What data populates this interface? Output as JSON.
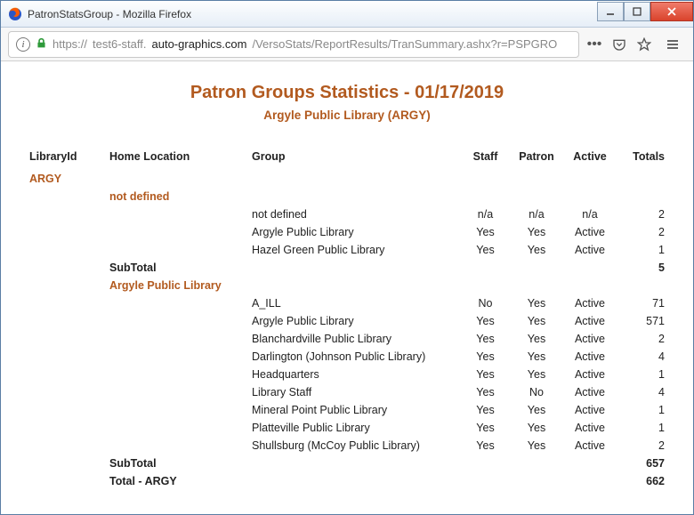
{
  "window": {
    "title": "PatronStatsGroup - Mozilla Firefox"
  },
  "address": {
    "protocol": "https://",
    "host_pre": "test6-staff.",
    "host_main": "auto-graphics.com",
    "path": "/VersoStats/ReportResults/TranSummary.ashx?r=PSPGRO"
  },
  "report": {
    "title": "Patron Groups Statistics  -  01/17/2019",
    "subtitle": "Argyle Public Library (ARGY)"
  },
  "columns": {
    "c0": "LibraryId",
    "c1": "Home Location",
    "c2": "Group",
    "c3": "Staff",
    "c4": "Patron",
    "c5": "Active",
    "c6": "Totals"
  },
  "library_id": "ARGY",
  "sections": [
    {
      "name": "not defined",
      "rows": [
        {
          "group": "not defined",
          "staff": "n/a",
          "patron": "n/a",
          "active": "n/a",
          "total": "2"
        },
        {
          "group": "Argyle Public Library",
          "staff": "Yes",
          "patron": "Yes",
          "active": "Active",
          "total": "2"
        },
        {
          "group": "Hazel Green Public Library",
          "staff": "Yes",
          "patron": "Yes",
          "active": "Active",
          "total": "1"
        }
      ],
      "subtotal_label": "SubTotal",
      "subtotal": "5"
    },
    {
      "name": "Argyle Public Library",
      "rows": [
        {
          "group": "A_ILL",
          "staff": "No",
          "patron": "Yes",
          "active": "Active",
          "total": "71"
        },
        {
          "group": "Argyle Public Library",
          "staff": "Yes",
          "patron": "Yes",
          "active": "Active",
          "total": "571"
        },
        {
          "group": "Blanchardville Public Library",
          "staff": "Yes",
          "patron": "Yes",
          "active": "Active",
          "total": "2"
        },
        {
          "group": "Darlington (Johnson Public Library)",
          "staff": "Yes",
          "patron": "Yes",
          "active": "Active",
          "total": "4"
        },
        {
          "group": "Headquarters",
          "staff": "Yes",
          "patron": "Yes",
          "active": "Active",
          "total": "1"
        },
        {
          "group": "Library Staff",
          "staff": "Yes",
          "patron": "No",
          "active": "Active",
          "total": "4"
        },
        {
          "group": "Mineral Point Public Library",
          "staff": "Yes",
          "patron": "Yes",
          "active": "Active",
          "total": "1"
        },
        {
          "group": "Platteville Public Library",
          "staff": "Yes",
          "patron": "Yes",
          "active": "Active",
          "total": "1"
        },
        {
          "group": "Shullsburg (McCoy Public Library)",
          "staff": "Yes",
          "patron": "Yes",
          "active": "Active",
          "total": "2"
        }
      ],
      "subtotal_label": "SubTotal",
      "subtotal": "657"
    }
  ],
  "grand_total_label": "Total  - ARGY",
  "grand_total": "662"
}
